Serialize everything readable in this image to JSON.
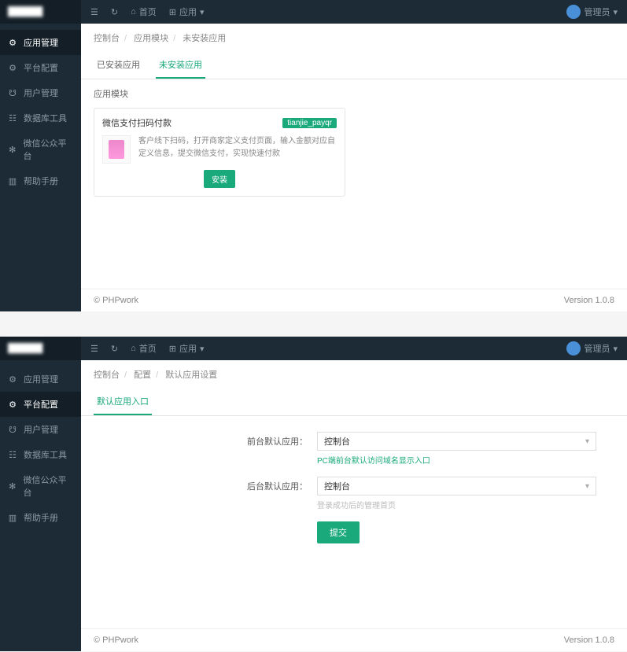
{
  "colors": {
    "accent": "#19a97b",
    "sidebar_bg": "#1c2b36"
  },
  "topbar": {
    "home": "首页",
    "apps": "应用",
    "user": "管理员"
  },
  "panel1": {
    "breadcrumb": [
      "控制台",
      "应用模块",
      "未安装应用"
    ],
    "tabs": [
      "已安装应用",
      "未安装应用"
    ],
    "active_tab": 1,
    "section_title": "应用模块",
    "nav": [
      "应用管理",
      "平台配置",
      "用户管理",
      "数据库工具",
      "微信公众平台",
      "帮助手册"
    ],
    "active_nav": 0,
    "card": {
      "title": "微信支付扫码付款",
      "badge": "tianjie_payqr",
      "desc": "客户线下扫码，打开商家定义支付页面，输入金额对应自定义信息，提交微信支付，实现快速付款",
      "install_btn": "安装"
    }
  },
  "panel2": {
    "breadcrumb": [
      "控制台",
      "配置",
      "默认应用设置"
    ],
    "tabs": [
      "默认应用入口"
    ],
    "active_tab": 0,
    "nav": [
      "应用管理",
      "平台配置",
      "用户管理",
      "数据库工具",
      "微信公众平台",
      "帮助手册"
    ],
    "active_nav": 1,
    "form": {
      "front_label": "前台默认应用：",
      "front_value": "控制台",
      "front_help": "PC端前台默认访问域名显示入口",
      "back_label": "后台默认应用：",
      "back_value": "控制台",
      "back_help": "登录成功后的管理首页",
      "submit": "提交"
    }
  },
  "footer": {
    "copyright": "© PHPwork",
    "version": "Version 1.0.8"
  }
}
